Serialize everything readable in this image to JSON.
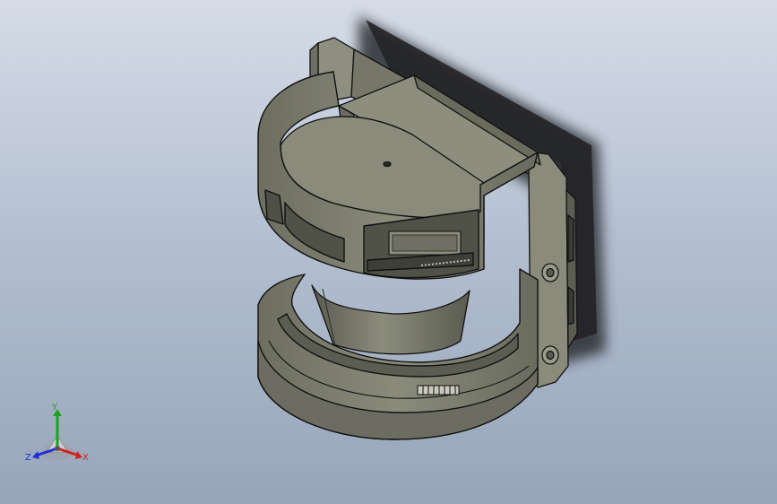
{
  "viewport": {
    "background_top": "#d5dce7",
    "background_bottom": "#97a5ba",
    "model": {
      "icon": "sensor-housing-3d-model",
      "body_color": "#7e7f70",
      "edge_color": "#111111",
      "shadow_color": "#2c2d30"
    }
  },
  "triad": {
    "icon": "coordinate-triad-icon",
    "x_label": "X",
    "y_label": "Y",
    "z_label": "Z",
    "x_color": "#d42020",
    "y_color": "#20a020",
    "z_color": "#2030d0"
  }
}
